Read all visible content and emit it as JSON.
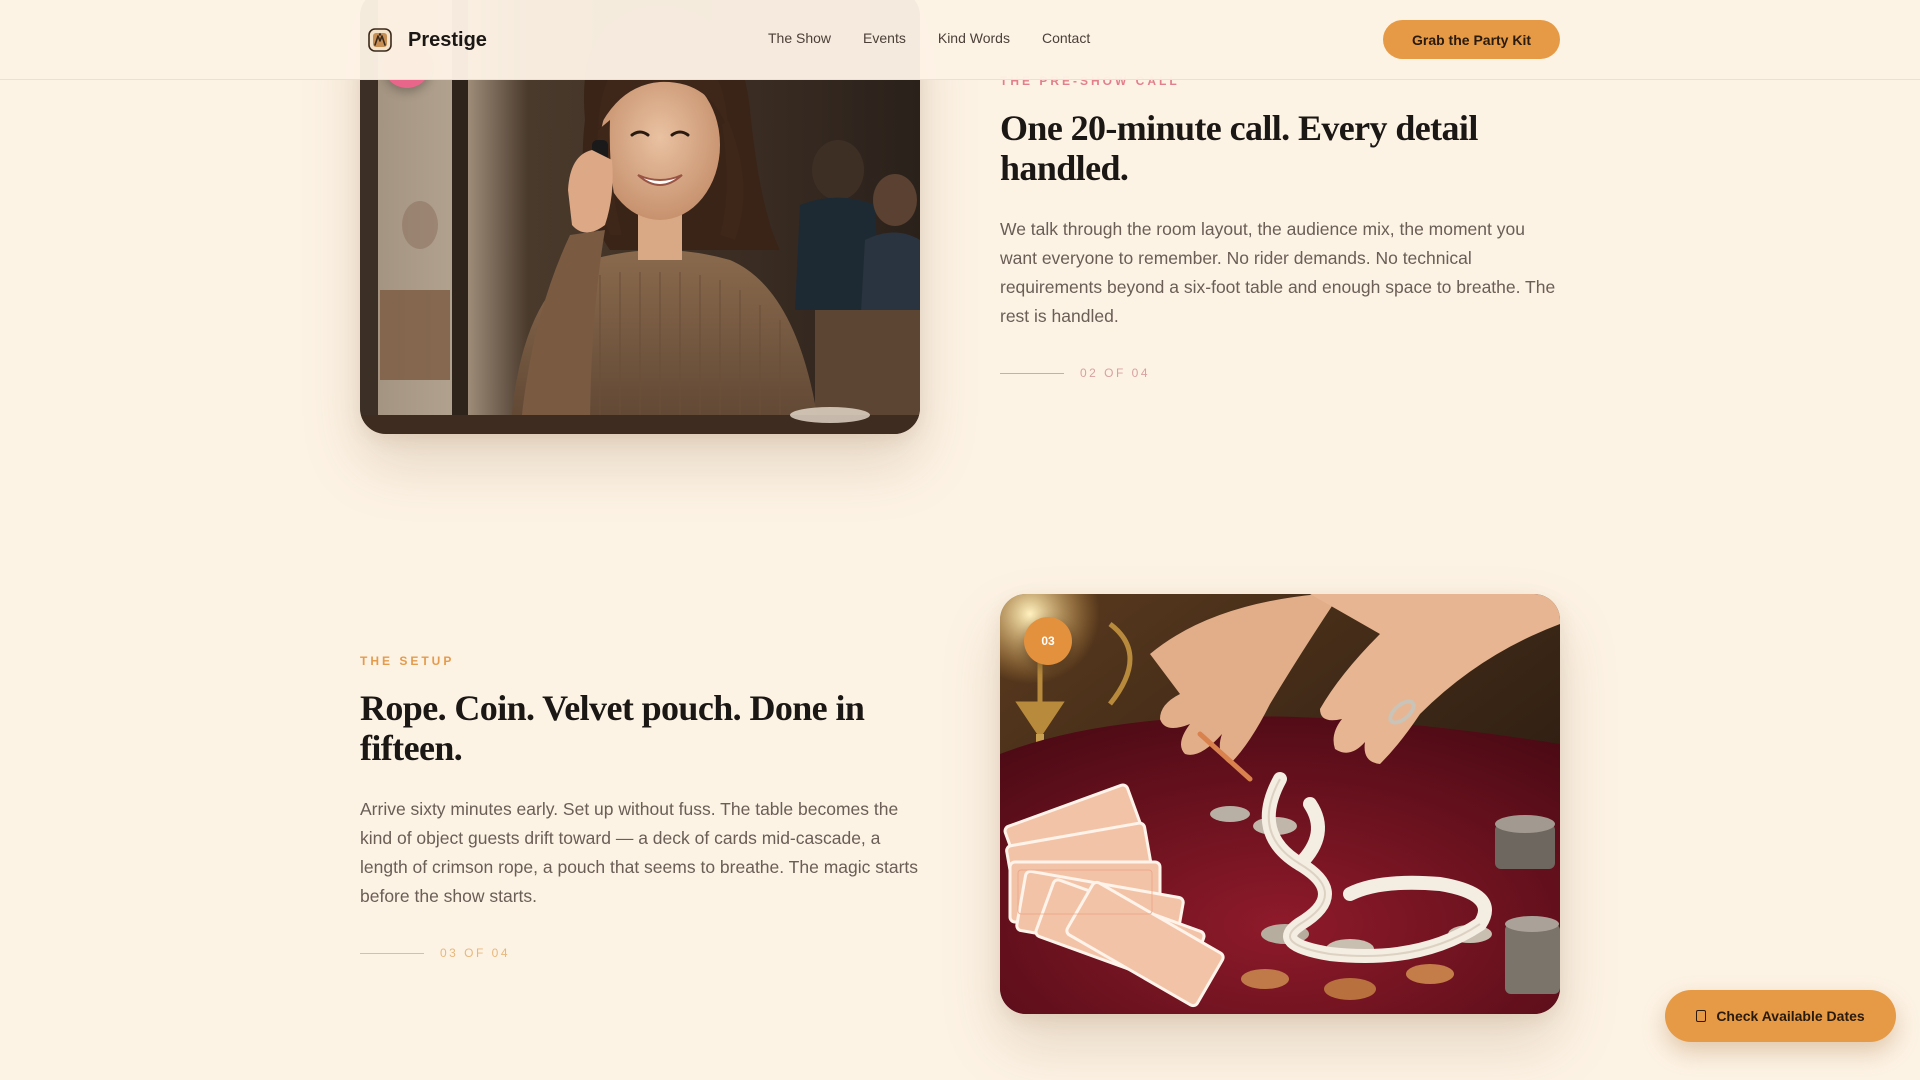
{
  "nav": {
    "brand": "Prestige",
    "links": [
      "The Show",
      "Events",
      "Kind Words",
      "Contact"
    ],
    "cta": "Grab the Party Kit"
  },
  "steps": [
    {
      "eyebrow": "The Pre-Show Call",
      "heading": "One 20-minute call. Every detail handled.",
      "body": "We talk through the room layout, the audience mix, the moment you want everyone to remember. No rider demands. No technical requirements beyond a six-foot table and enough space to breathe. The rest is handled.",
      "counter": "02 of 04"
    },
    {
      "eyebrow": "The Setup",
      "heading": "Rope. Coin. Velvet pouch. Done in fifteen.",
      "body": "Arrive sixty minutes early. Set up without fuss. The table becomes the kind of object guests drift toward — a deck of cards mid-cascade, a length of crimson rope, a pouch that seems to breathe. The magic starts before the show starts.",
      "counter": "03 of 04",
      "badge": "03"
    }
  ],
  "floating_cta": {
    "label": "Check Available Dates",
    "icon": "calendar-icon"
  },
  "colors": {
    "background": "#fdf3e5",
    "accent": "#e69a45",
    "pink_accent": "#e27f8d",
    "text": "#1b1714",
    "muted": "#6a5e55"
  }
}
